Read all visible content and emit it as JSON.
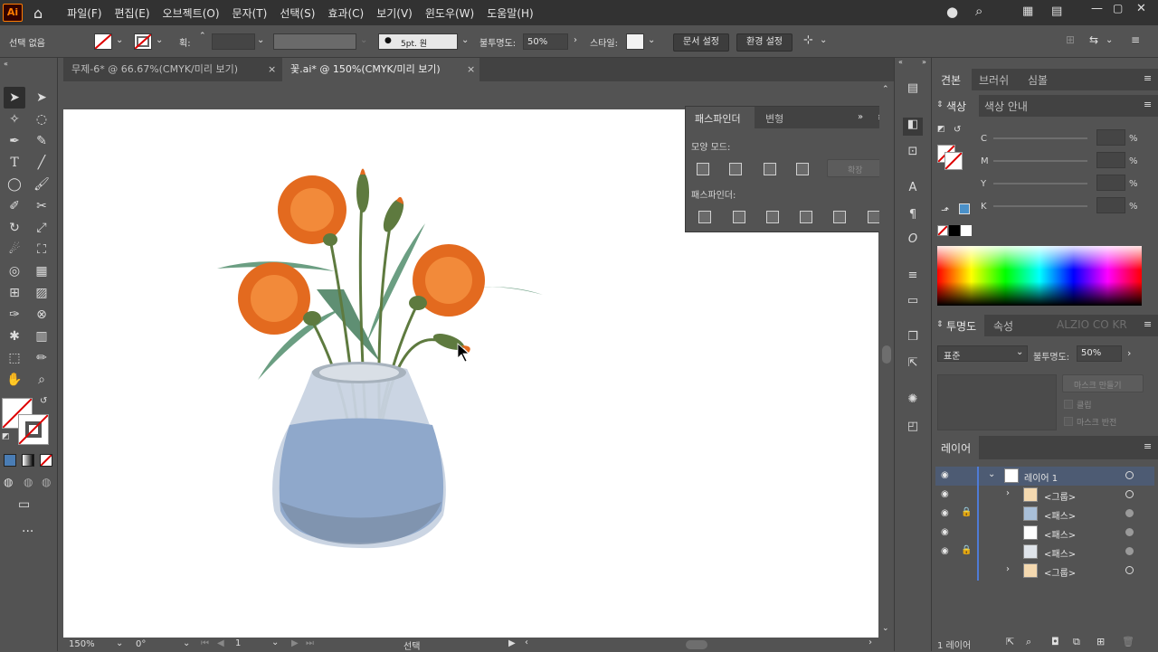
{
  "app": {
    "logo": "Ai"
  },
  "menu": [
    "파일(F)",
    "편집(E)",
    "오브젝트(O)",
    "문자(T)",
    "선택(S)",
    "효과(C)",
    "보기(V)",
    "윈도우(W)",
    "도움말(H)"
  ],
  "control": {
    "selection": "선택 없음",
    "stroke_label": "획:",
    "brush": "5pt. 원",
    "opacity_label": "불투명도:",
    "opacity_value": "50%",
    "style_label": "스타일:",
    "doc_setup": "문서 설정",
    "prefs": "환경 설정"
  },
  "tabs": [
    {
      "label": "무제-6* @ 66.67%(CMYK/미리 보기)",
      "close": "×"
    },
    {
      "label": "꽃.ai* @ 150%(CMYK/미리 보기)",
      "close": "×"
    }
  ],
  "pathfinder": {
    "tabs": [
      "패스파인더",
      "변형"
    ],
    "shape_modes": "모양 모드:",
    "expand": "확장",
    "pathfinders": "패스파인더:"
  },
  "color_panel": {
    "tabs": [
      "견본",
      "브러쉬",
      "심볼"
    ],
    "sub_tabs": [
      "색상",
      "색상 안내"
    ],
    "channels": [
      {
        "label": "C",
        "pct": "%"
      },
      {
        "label": "M",
        "pct": "%"
      },
      {
        "label": "Y",
        "pct": "%"
      },
      {
        "label": "K",
        "pct": "%"
      }
    ],
    "swatch_color": "#4a90c8"
  },
  "transparency": {
    "tabs": [
      "투명도",
      "속성"
    ],
    "watermark": "ALZIO CO KR",
    "blend": "표준",
    "opacity_label": "불투명도:",
    "opacity_value": "50%",
    "make_mask": "마스크 만들기",
    "clip": "클립",
    "invert": "마스크 반전"
  },
  "layers": {
    "tab": "레이어",
    "rows": [
      {
        "name": "레이어 1",
        "locked": false,
        "expand": "⌄"
      },
      {
        "name": "<그룹>",
        "locked": false,
        "expand": "›"
      },
      {
        "name": "<패스>",
        "locked": true,
        "expand": ""
      },
      {
        "name": "<패스>",
        "locked": false,
        "expand": ""
      },
      {
        "name": "<패스>",
        "locked": true,
        "expand": ""
      },
      {
        "name": "<그룹>",
        "locked": false,
        "expand": "›"
      }
    ],
    "count": "1 레이어"
  },
  "status": {
    "zoom": "150%",
    "rotation": "0°",
    "artboard": "1",
    "mode": "선택"
  }
}
